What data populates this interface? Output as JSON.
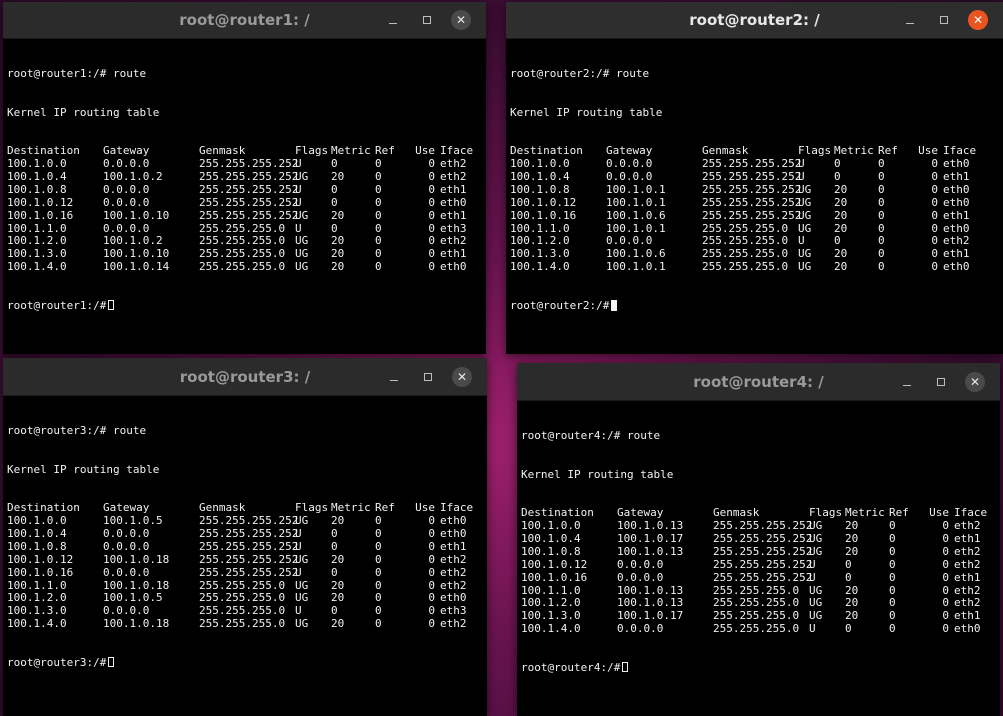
{
  "windows": [
    {
      "title": "root@router1: /",
      "prompt": "root@router1:/#",
      "command": "route",
      "heading": "Kernel IP routing table",
      "columns": [
        "Destination",
        "Gateway",
        "Genmask",
        "Flags",
        "Metric",
        "Ref",
        "Use",
        "Iface"
      ],
      "rows": [
        [
          "100.1.0.0",
          "0.0.0.0",
          "255.255.255.252",
          "U",
          "0",
          "0",
          "0",
          "eth2"
        ],
        [
          "100.1.0.4",
          "100.1.0.2",
          "255.255.255.252",
          "UG",
          "20",
          "0",
          "0",
          "eth2"
        ],
        [
          "100.1.0.8",
          "0.0.0.0",
          "255.255.255.252",
          "U",
          "0",
          "0",
          "0",
          "eth1"
        ],
        [
          "100.1.0.12",
          "0.0.0.0",
          "255.255.255.252",
          "U",
          "0",
          "0",
          "0",
          "eth0"
        ],
        [
          "100.1.0.16",
          "100.1.0.10",
          "255.255.255.252",
          "UG",
          "20",
          "0",
          "0",
          "eth1"
        ],
        [
          "100.1.1.0",
          "0.0.0.0",
          "255.255.255.0",
          "U",
          "0",
          "0",
          "0",
          "eth3"
        ],
        [
          "100.1.2.0",
          "100.1.0.2",
          "255.255.255.0",
          "UG",
          "20",
          "0",
          "0",
          "eth2"
        ],
        [
          "100.1.3.0",
          "100.1.0.10",
          "255.255.255.0",
          "UG",
          "20",
          "0",
          "0",
          "eth1"
        ],
        [
          "100.1.4.0",
          "100.1.0.14",
          "255.255.255.0",
          "UG",
          "20",
          "0",
          "0",
          "eth0"
        ]
      ]
    },
    {
      "title": "root@router2: /",
      "prompt": "root@router2:/#",
      "command": "route",
      "heading": "Kernel IP routing table",
      "columns": [
        "Destination",
        "Gateway",
        "Genmask",
        "Flags",
        "Metric",
        "Ref",
        "Use",
        "Iface"
      ],
      "rows": [
        [
          "100.1.0.0",
          "0.0.0.0",
          "255.255.255.252",
          "U",
          "0",
          "0",
          "0",
          "eth0"
        ],
        [
          "100.1.0.4",
          "0.0.0.0",
          "255.255.255.252",
          "U",
          "0",
          "0",
          "0",
          "eth1"
        ],
        [
          "100.1.0.8",
          "100.1.0.1",
          "255.255.255.252",
          "UG",
          "20",
          "0",
          "0",
          "eth0"
        ],
        [
          "100.1.0.12",
          "100.1.0.1",
          "255.255.255.252",
          "UG",
          "20",
          "0",
          "0",
          "eth0"
        ],
        [
          "100.1.0.16",
          "100.1.0.6",
          "255.255.255.252",
          "UG",
          "20",
          "0",
          "0",
          "eth1"
        ],
        [
          "100.1.1.0",
          "100.1.0.1",
          "255.255.255.0",
          "UG",
          "20",
          "0",
          "0",
          "eth0"
        ],
        [
          "100.1.2.0",
          "0.0.0.0",
          "255.255.255.0",
          "U",
          "0",
          "0",
          "0",
          "eth2"
        ],
        [
          "100.1.3.0",
          "100.1.0.6",
          "255.255.255.0",
          "UG",
          "20",
          "0",
          "0",
          "eth1"
        ],
        [
          "100.1.4.0",
          "100.1.0.1",
          "255.255.255.0",
          "UG",
          "20",
          "0",
          "0",
          "eth0"
        ]
      ]
    },
    {
      "title": "root@router3: /",
      "prompt": "root@router3:/#",
      "command": "route",
      "heading": "Kernel IP routing table",
      "columns": [
        "Destination",
        "Gateway",
        "Genmask",
        "Flags",
        "Metric",
        "Ref",
        "Use",
        "Iface"
      ],
      "rows": [
        [
          "100.1.0.0",
          "100.1.0.5",
          "255.255.255.252",
          "UG",
          "20",
          "0",
          "0",
          "eth0"
        ],
        [
          "100.1.0.4",
          "0.0.0.0",
          "255.255.255.252",
          "U",
          "0",
          "0",
          "0",
          "eth0"
        ],
        [
          "100.1.0.8",
          "0.0.0.0",
          "255.255.255.252",
          "U",
          "0",
          "0",
          "0",
          "eth1"
        ],
        [
          "100.1.0.12",
          "100.1.0.18",
          "255.255.255.252",
          "UG",
          "20",
          "0",
          "0",
          "eth2"
        ],
        [
          "100.1.0.16",
          "0.0.0.0",
          "255.255.255.252",
          "U",
          "0",
          "0",
          "0",
          "eth2"
        ],
        [
          "100.1.1.0",
          "100.1.0.18",
          "255.255.255.0",
          "UG",
          "20",
          "0",
          "0",
          "eth2"
        ],
        [
          "100.1.2.0",
          "100.1.0.5",
          "255.255.255.0",
          "UG",
          "20",
          "0",
          "0",
          "eth0"
        ],
        [
          "100.1.3.0",
          "0.0.0.0",
          "255.255.255.0",
          "U",
          "0",
          "0",
          "0",
          "eth3"
        ],
        [
          "100.1.4.0",
          "100.1.0.18",
          "255.255.255.0",
          "UG",
          "20",
          "0",
          "0",
          "eth2"
        ]
      ]
    },
    {
      "title": "root@router4: /",
      "prompt": "root@router4:/#",
      "command": "route",
      "heading": "Kernel IP routing table",
      "columns": [
        "Destination",
        "Gateway",
        "Genmask",
        "Flags",
        "Metric",
        "Ref",
        "Use",
        "Iface"
      ],
      "rows": [
        [
          "100.1.0.0",
          "100.1.0.13",
          "255.255.255.252",
          "UG",
          "20",
          "0",
          "0",
          "eth2"
        ],
        [
          "100.1.0.4",
          "100.1.0.17",
          "255.255.255.252",
          "UG",
          "20",
          "0",
          "0",
          "eth1"
        ],
        [
          "100.1.0.8",
          "100.1.0.13",
          "255.255.255.252",
          "UG",
          "20",
          "0",
          "0",
          "eth2"
        ],
        [
          "100.1.0.12",
          "0.0.0.0",
          "255.255.255.252",
          "U",
          "0",
          "0",
          "0",
          "eth2"
        ],
        [
          "100.1.0.16",
          "0.0.0.0",
          "255.255.255.252",
          "U",
          "0",
          "0",
          "0",
          "eth1"
        ],
        [
          "100.1.1.0",
          "100.1.0.13",
          "255.255.255.0",
          "UG",
          "20",
          "0",
          "0",
          "eth2"
        ],
        [
          "100.1.2.0",
          "100.1.0.13",
          "255.255.255.0",
          "UG",
          "20",
          "0",
          "0",
          "eth2"
        ],
        [
          "100.1.3.0",
          "100.1.0.17",
          "255.255.255.0",
          "UG",
          "20",
          "0",
          "0",
          "eth1"
        ],
        [
          "100.1.4.0",
          "0.0.0.0",
          "255.255.255.0",
          "U",
          "0",
          "0",
          "0",
          "eth0"
        ]
      ]
    }
  ],
  "window_controls": {
    "minimize": "–",
    "maximize": "□",
    "close": "✕"
  },
  "colors": {
    "close_active": "#e95420",
    "titlebar": "#2b2b2b",
    "terminal_bg": "#000000",
    "terminal_fg": "#f2f2f2"
  }
}
